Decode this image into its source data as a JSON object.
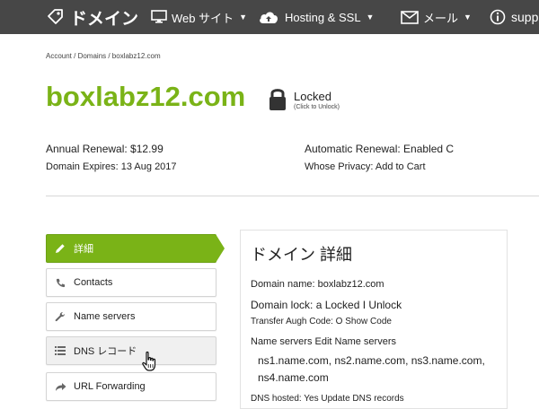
{
  "nav": {
    "domains": "ドメイン",
    "web": "Web サイト",
    "hosting": "Hosting & SSL",
    "mail": "メール",
    "support": "supp"
  },
  "breadcrumb": "Account / Domains / boxlabz12.com",
  "domain": {
    "name": "boxlabz12.com",
    "lock_status": "Locked",
    "lock_hint": "(Click to Unlock)"
  },
  "info": {
    "annual_renewal": "Annual Renewal: $12.99",
    "domain_expires": "Domain Expires: 13 Aug 2017",
    "auto_renewal": "Automatic Renewal: Enabled C",
    "whois_privacy": "Whose Privacy: Add to Cart"
  },
  "menu": [
    {
      "label": "詳細",
      "icon": "pencil-icon"
    },
    {
      "label": "Contacts",
      "icon": "phone-icon"
    },
    {
      "label": "Name servers",
      "icon": "wrench-icon"
    },
    {
      "label": "DNS レコード",
      "icon": "list-icon"
    },
    {
      "label": "URL Forwarding",
      "icon": "share-arrow-icon"
    }
  ],
  "details": {
    "title": "ドメイン 詳細",
    "domain_name": "Domain name: boxlabz12.com",
    "domain_lock": "Domain lock: a Locked I Unlock",
    "transfer_auth": "Transfer Augh Code: O Show Code",
    "name_servers": "Name servers Edit Name servers",
    "ns_values": "ns1.name.com, ns2.name.com, ns3.name.com, ns4.name.com",
    "dns_hosted": "DNS hosted: Yes Update DNS records"
  },
  "colors": {
    "accent": "#7ab317",
    "nav_bg": "#474747"
  }
}
